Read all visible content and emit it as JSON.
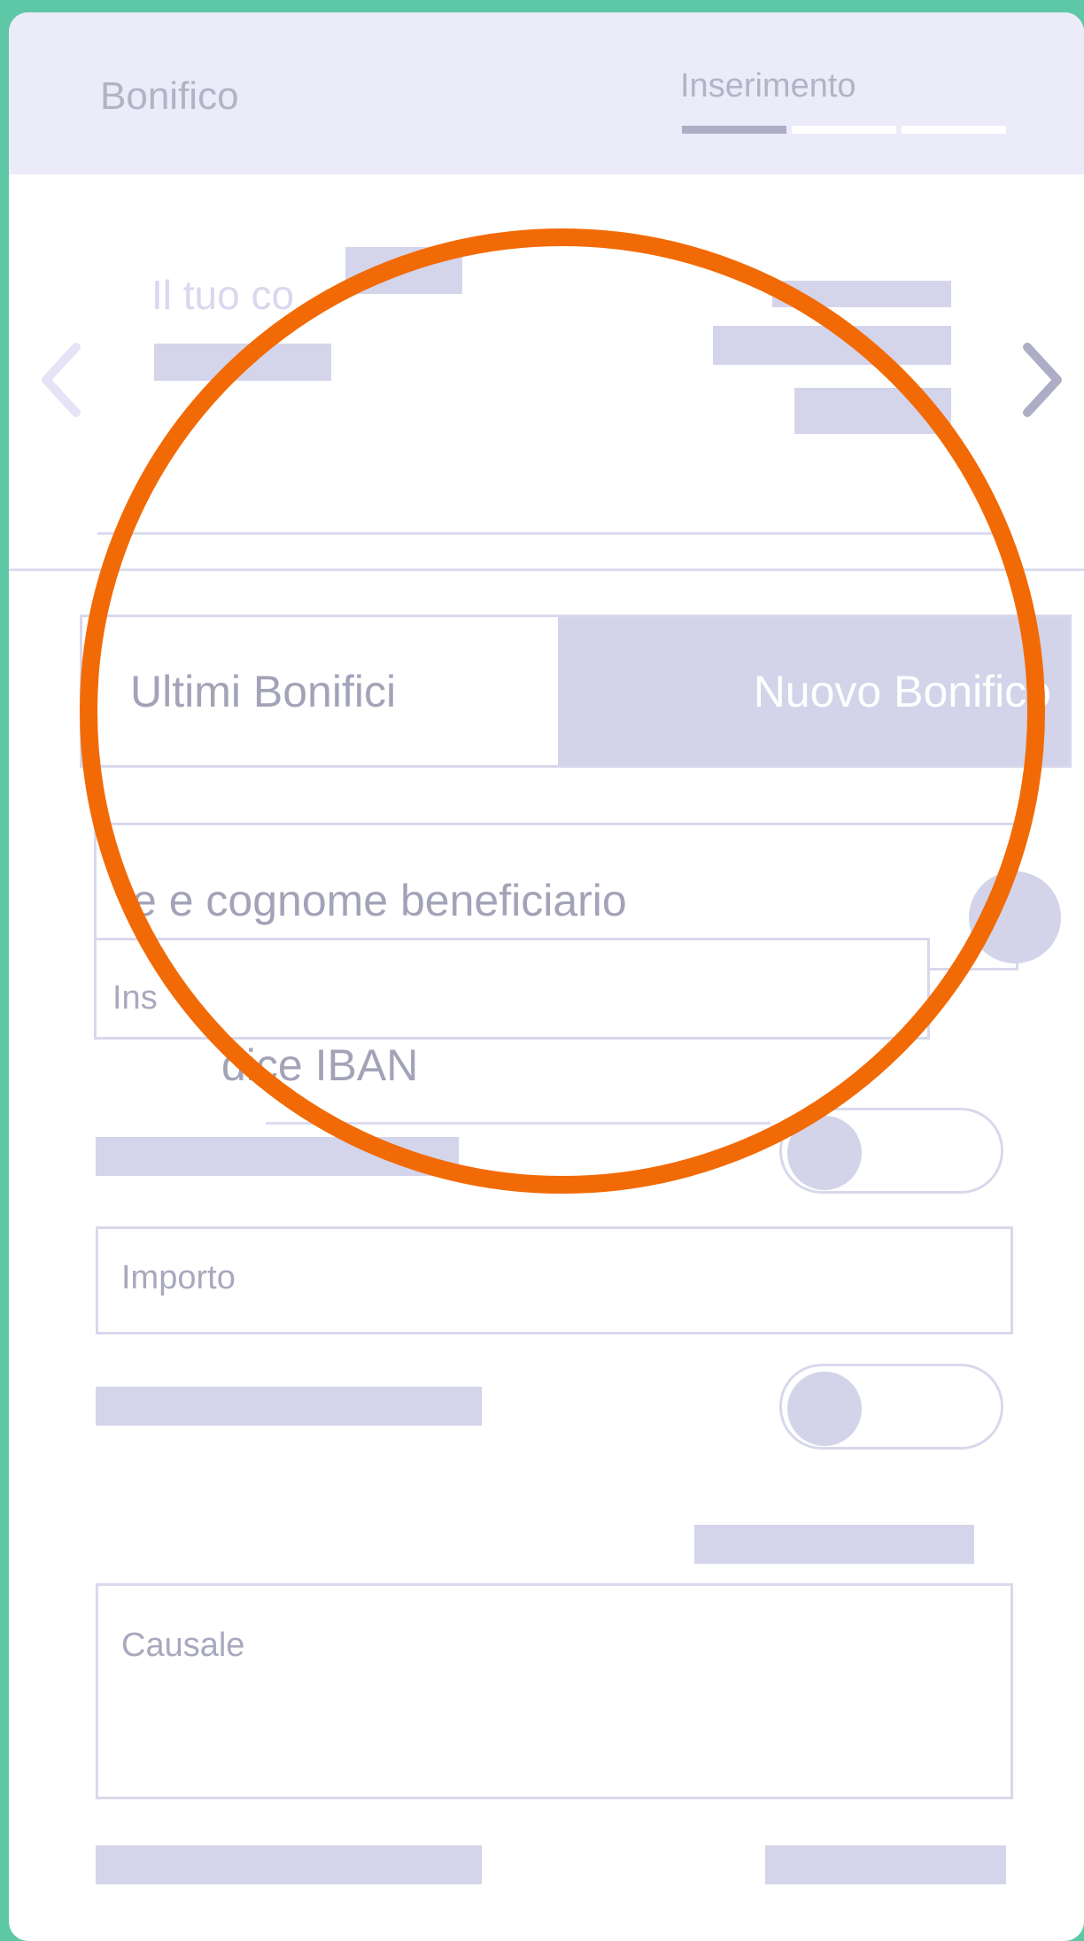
{
  "header": {
    "title": "Bonifico",
    "step_label": "Inserimento",
    "steps_total": 3,
    "steps_active": 1
  },
  "account": {
    "label": "Il tuo co"
  },
  "tabs": {
    "recent": "Ultimi Bonifici",
    "new": "Nuovo Bonifico",
    "selected": "Nuovo Bonifico"
  },
  "form": {
    "beneficiary_name": "e e cognome beneficiario",
    "beneficiary_small": "Ins",
    "iban": "dice IBAN",
    "amount_placeholder": "Importo",
    "reason_placeholder": "Causale"
  },
  "colors": {
    "background": "#5ec7a5",
    "header": "#ebebfa",
    "placeholder_bar": "#d4d4ea",
    "selected_tab": "#d3d3e9",
    "highlight_ring": "#f26a06"
  }
}
